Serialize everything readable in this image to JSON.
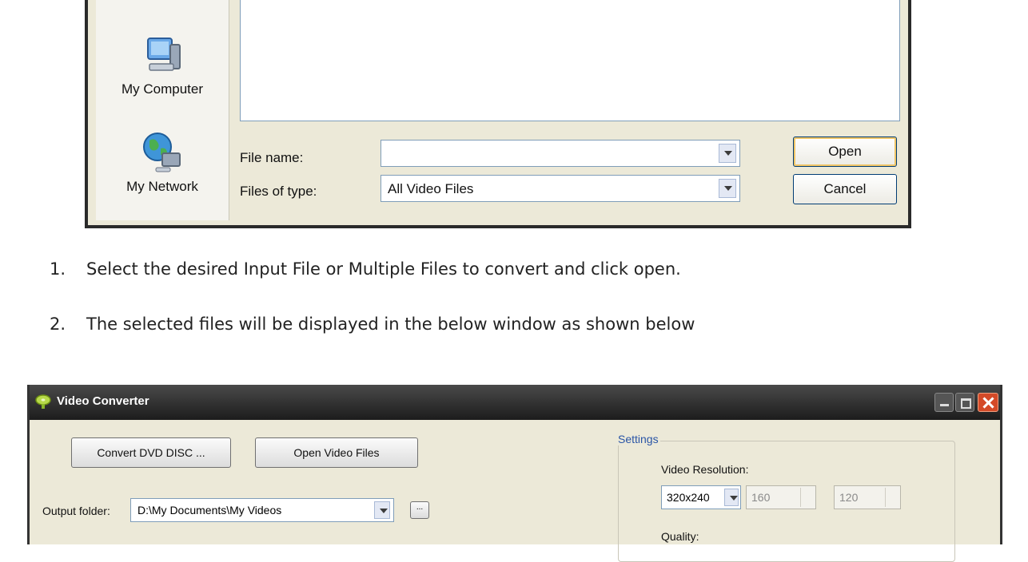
{
  "open_dialog": {
    "places": [
      "My Computer",
      "My Network"
    ],
    "file_name_label": "File name:",
    "file_name_value": "",
    "file_type_label": "Files of type:",
    "file_type_value": "All Video Files",
    "open_button": "Open",
    "cancel_button": "Cancel"
  },
  "instructions": [
    {
      "number": "1.",
      "text": "Select the desired Input File or Multiple Files to convert and click open."
    },
    {
      "number": "2.",
      "text": "The selected files will be displayed in the below window as shown below"
    }
  ],
  "video_converter": {
    "title": "Video Converter",
    "convert_dvd_button": "Convert DVD DISC ...",
    "open_video_files_button": "Open Video Files",
    "output_folder_label": "Output folder:",
    "output_folder_value": "D:\\My Documents\\My Videos",
    "browse_button": "...",
    "settings_group": "Settings",
    "video_resolution_label": "Video Resolution:",
    "resolution_value": "320x240",
    "width_value": "160",
    "height_value": "120",
    "quality_label": "Quality:"
  }
}
